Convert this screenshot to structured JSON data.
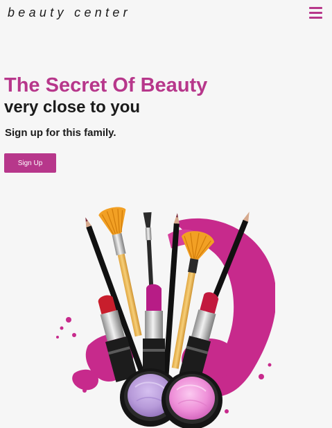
{
  "header": {
    "brand": "beauty center",
    "menu_icon": "hamburger-menu-icon"
  },
  "hero": {
    "title": "The Secret Of Beauty",
    "subtitle": "very close to you",
    "text": "Sign up for this family.",
    "signup_label": "Sign Up",
    "image_name": "makeup-cosmetics-illustration"
  },
  "colors": {
    "accent": "#b7378b",
    "text": "#1b1b1b",
    "background": "#f6f6f6",
    "button_text": "#ffffff"
  }
}
